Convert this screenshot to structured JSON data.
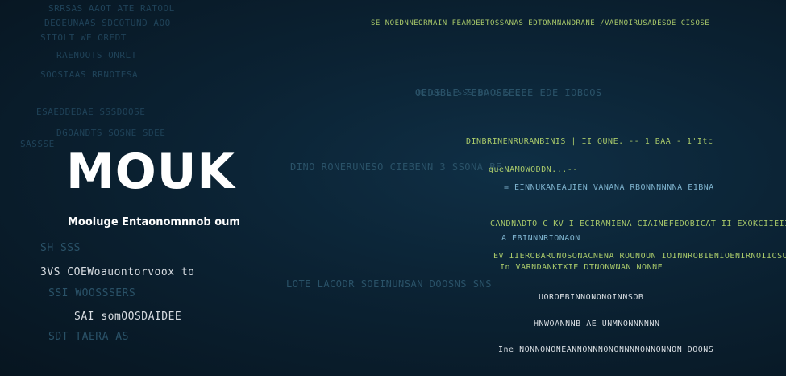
{
  "title": "MOUK",
  "subtitle": "Mooiuge Entaonomnnob oum",
  "left_lines": [
    "SRRSAS AAOT ATE RATOOL",
    "DEOEUNAAS SDCOTUND AOO",
    "SITOLT WE OREDT",
    "RAENOOTS ONRLT",
    "SOOSIAAS RRNOTESA",
    "ESAEDDEDAE SSSDOOSE",
    "DGOANDTS SOSNE SDEE",
    "SASSSE",
    "SH SSS",
    "3VS COEWoauontorvoox to",
    "SSI WOOSSSERS",
    "SAI somOOSDAIDEE",
    "SDT TAERA AS"
  ],
  "middle_lines": [
    "DINO RONERUNESO CIEBENN 3 SSONA BE",
    "OEDSBLE TEBAOSEEEEE EDE IOBOOS",
    "LOTE LACODR SOEINUNSAN DOOSNS SNS"
  ],
  "right_lines": [
    {
      "text": "SE NOEDNNEORMAIN FEAMOEBTOSSANAS EDTONMNANDRANE /VAENOIRUSADESOE CISOSE",
      "tone": "grn"
    },
    {
      "text": "OE OE S SSS OO O S E",
      "tone": "dim2"
    },
    {
      "text": "DINBRINENRURANBINIS | II OUNE. -- 1 BAA - 1'Itc",
      "tone": "grn"
    },
    {
      "text": "gueNAMOWODDN...--",
      "tone": "grn"
    },
    {
      "text": "= EINNUKANEAUIEN  VANANA RBONNNNNNA E1BNA",
      "tone": "cy"
    },
    {
      "text": "CANDNADTO  C  KV I ECIRAMIENA CIAINEFEDOBICAT II EXOKCIIEII :",
      "tone": "grn"
    },
    {
      "text": "A EBINNNRIONAON",
      "tone": "cy"
    },
    {
      "text": "EV IIEROBARUNOSONACNENA ROUNOUN IOINNROBIENIOENIRNOIIOSUON",
      "tone": "grn"
    },
    {
      "text": "In  VARNDANKTXIE DTNONWNAN NONNE",
      "tone": "grn"
    },
    {
      "text": "UOROEBINNONONOINNSOB",
      "tone": "wh"
    },
    {
      "text": "HNWOANNNB AE UNMNONNNNNN",
      "tone": "wh"
    },
    {
      "text": "Ine NONNONONEANNONNNONONNNNONNONNON DOONS",
      "tone": "wh"
    }
  ]
}
